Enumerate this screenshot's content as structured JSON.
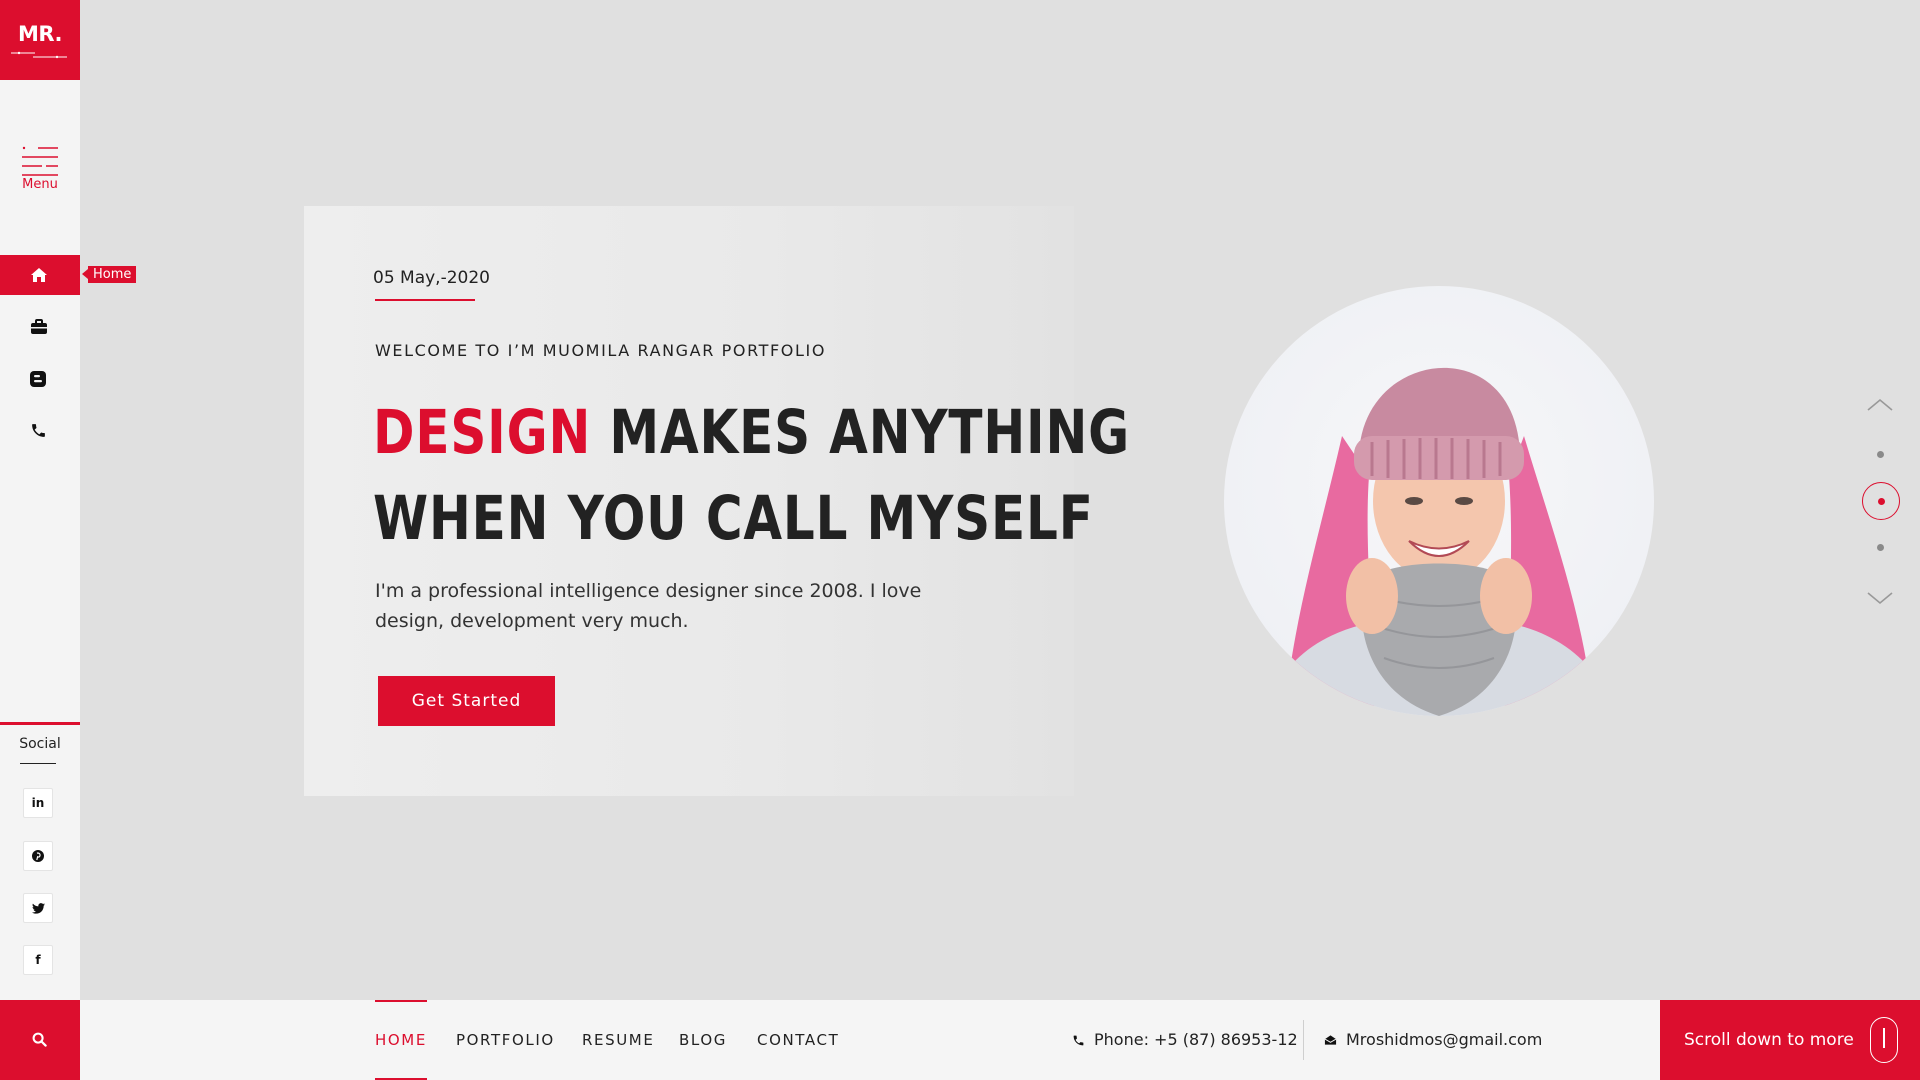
{
  "brand": {
    "logo_text": "MR.",
    "accent_color": "#dc0e2e"
  },
  "sidebar": {
    "menu_label": "Menu",
    "nav_items": [
      {
        "name": "home",
        "icon": "home-icon",
        "active": true,
        "tooltip": "Home"
      },
      {
        "name": "portfolio",
        "icon": "briefcase-icon",
        "active": false
      },
      {
        "name": "blog",
        "icon": "blogger-icon",
        "active": false
      },
      {
        "name": "contact",
        "icon": "phone-icon",
        "active": false
      }
    ],
    "social_title": "Social",
    "social": [
      {
        "name": "linkedin",
        "icon": "linkedin-icon",
        "glyph": "in"
      },
      {
        "name": "pinterest",
        "icon": "pinterest-icon",
        "glyph": "p"
      },
      {
        "name": "twitter",
        "icon": "twitter-icon",
        "glyph": "t"
      },
      {
        "name": "facebook",
        "icon": "facebook-icon",
        "glyph": "f"
      }
    ],
    "search_icon": "search-icon"
  },
  "hero": {
    "date": "05 May,-2020",
    "welcome": "WELCOME TO I’M MUOMILA RANGAR PORTFOLIO",
    "headline_accent": "DESIGN",
    "headline_line1_rest": " MAKES ANYTHING",
    "headline_line2": "WHEN YOU CALL MYSELF",
    "description": "I'm a professional intelligence designer since 2008. I love design, development very much.",
    "cta_label": "Get Started"
  },
  "pager": {
    "dots": 3,
    "active_index": 1
  },
  "bottom_nav": [
    {
      "label": "HOME",
      "active": true
    },
    {
      "label": "PORTFOLIO",
      "active": false
    },
    {
      "label": "RESUME",
      "active": false
    },
    {
      "label": "BLOG",
      "active": false
    },
    {
      "label": "CONTACT",
      "active": false
    }
  ],
  "contact": {
    "phone": "Phone: +5 (87) 86953-12",
    "email": "Mroshidmos@gmail.com"
  },
  "scroll_prompt": "Scroll down to more"
}
